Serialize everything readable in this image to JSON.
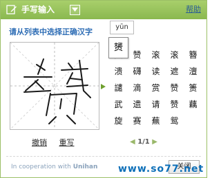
{
  "titlebar": {
    "title": "手写输入",
    "help_label": "帮助"
  },
  "instruction": "请从列表中选择正确汉字",
  "tooltip": {
    "pinyin": "yūn",
    "character": "赟"
  },
  "candidates": [
    "赟",
    "赞",
    "滚",
    "滚",
    "簪",
    "溃",
    "礴",
    "读",
    "遮",
    "澶",
    "譴",
    "滴",
    "赏",
    "赞",
    "箦",
    "武",
    "遗",
    "请",
    "赞",
    "藕",
    "旋",
    "赛",
    "蕪",
    "鸳",
    ""
  ],
  "pager": {
    "text": "1/1"
  },
  "actions": {
    "undo_label": "撤销",
    "rewrite_label": "重写"
  },
  "footer": {
    "cooperation_prefix": "In cooperation with",
    "cooperation_partner": "Unihan",
    "close_label": "关闭"
  },
  "watermark": "www.so77.net",
  "colors": {
    "accent": "#8ab84f",
    "title_text": "#ffffff",
    "instruction": "#2e6db5"
  },
  "icons": {
    "title": "edit-icon",
    "dropdown": "chevron-down-icon",
    "pager_prev": "triangle-left-icon",
    "pager_next": "triangle-right-icon",
    "result_arrow": "triangle-right-icon"
  }
}
